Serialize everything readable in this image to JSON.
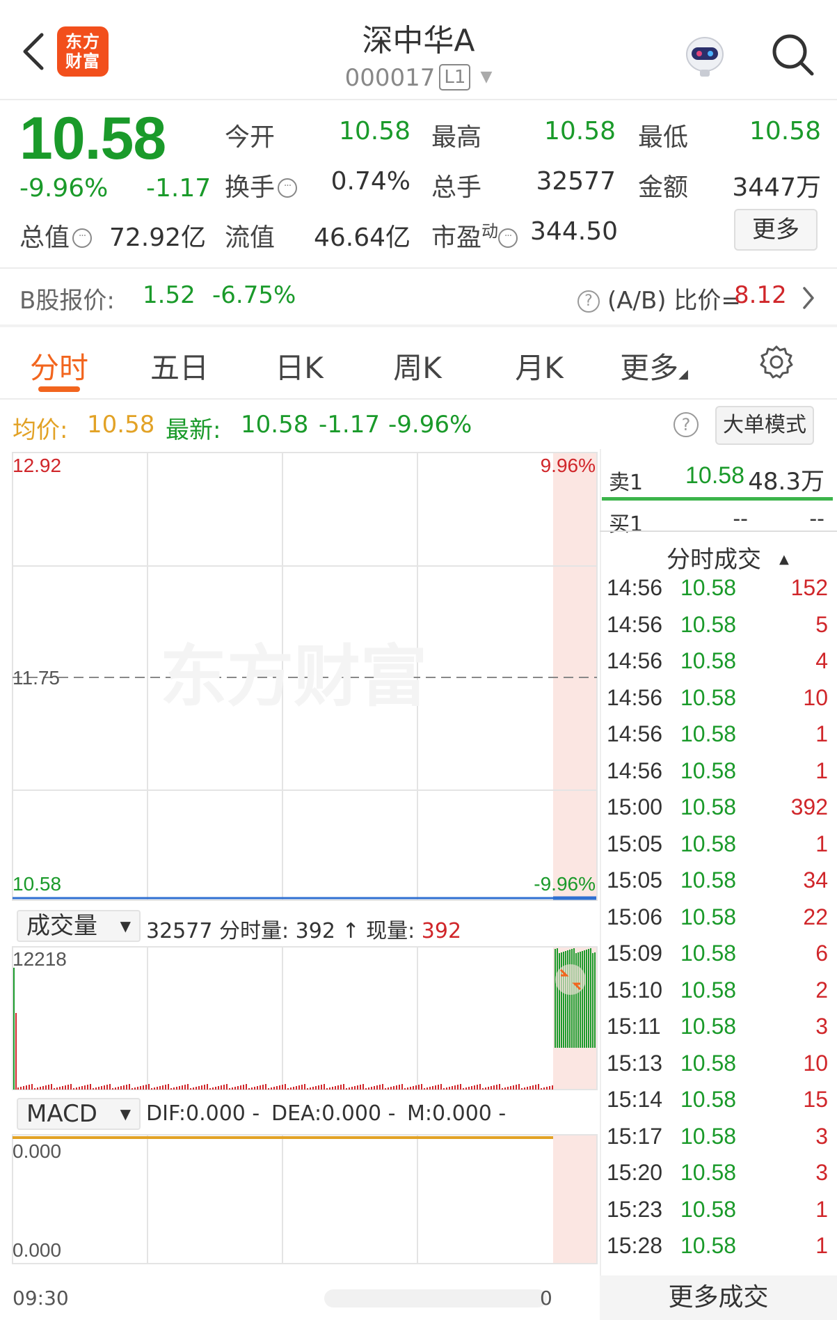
{
  "header": {
    "logo_line1": "东方",
    "logo_line2": "财富",
    "title": "深中华A",
    "code": "000017",
    "level_badge": "L1"
  },
  "quote": {
    "price": "10.58",
    "change_pct": "-9.96%",
    "change_abs": "-1.17",
    "open_label": "今开",
    "open_value": "10.58",
    "high_label": "最高",
    "high_value": "10.58",
    "low_label": "最低",
    "low_value": "10.58",
    "turnover_label": "换手",
    "turnover_value": "0.74%",
    "volume_label": "总手",
    "volume_value": "32577",
    "amount_label": "金额",
    "amount_value": "3447万",
    "mktcap_label": "总值",
    "mktcap_value": "72.92亿",
    "float_label": "流值",
    "float_value": "46.64亿",
    "pe_label": "市盈",
    "pe_sup": "动",
    "pe_value": "344.50",
    "more_label": "更多"
  },
  "bshare": {
    "label": "B股报价:",
    "price": "1.52",
    "pct": "-6.75%",
    "ratio_label": "(A/B) 比价=",
    "ratio_value": "8.12"
  },
  "tabs": [
    "分时",
    "五日",
    "日K",
    "周K",
    "月K",
    "更多"
  ],
  "chart_info": {
    "avg_label": "均价:",
    "avg_value": "10.58",
    "latest_label": "最新:",
    "latest_value": "10.58",
    "latest_chg": "-1.17",
    "latest_pct": "-9.96%",
    "bigorder_label": "大单模式"
  },
  "price_chart": {
    "y_top": "12.92",
    "y_mid": "11.75",
    "y_bottom": "10.58",
    "pct_top": "9.96%",
    "pct_bottom": "-9.96%",
    "watermark": "东方财富"
  },
  "volume_panel": {
    "select_label": "成交量",
    "total": "32577",
    "bar_label": "分时量:",
    "bar_value": "392",
    "now_label": "现量:",
    "now_value": "392",
    "y_max": "12218"
  },
  "macd_panel": {
    "select_label": "MACD",
    "dif": "DIF:0.000 -",
    "dea": "DEA:0.000 -",
    "m": "M:0.000 -",
    "y_top": "0.000",
    "y_bottom": "0.000",
    "x_start": "09:30",
    "x_end": "0"
  },
  "orderbook": {
    "sell1_label": "卖1",
    "sell1_price": "10.58",
    "sell1_vol": "48.3万",
    "buy1_label": "买1",
    "buy1_price": "--",
    "buy1_vol": "--",
    "trades_title": "分时成交",
    "more_trades": "更多成交"
  },
  "trades": [
    {
      "time": "14:56",
      "price": "10.58",
      "vol": "152"
    },
    {
      "time": "14:56",
      "price": "10.58",
      "vol": "5"
    },
    {
      "time": "14:56",
      "price": "10.58",
      "vol": "4"
    },
    {
      "time": "14:56",
      "price": "10.58",
      "vol": "10"
    },
    {
      "time": "14:56",
      "price": "10.58",
      "vol": "1"
    },
    {
      "time": "14:56",
      "price": "10.58",
      "vol": "1"
    },
    {
      "time": "15:00",
      "price": "10.58",
      "vol": "392"
    },
    {
      "time": "15:05",
      "price": "10.58",
      "vol": "1"
    },
    {
      "time": "15:05",
      "price": "10.58",
      "vol": "34"
    },
    {
      "time": "15:06",
      "price": "10.58",
      "vol": "22"
    },
    {
      "time": "15:09",
      "price": "10.58",
      "vol": "6"
    },
    {
      "time": "15:10",
      "price": "10.58",
      "vol": "2"
    },
    {
      "time": "15:11",
      "price": "10.58",
      "vol": "3"
    },
    {
      "time": "15:13",
      "price": "10.58",
      "vol": "10"
    },
    {
      "time": "15:14",
      "price": "10.58",
      "vol": "15"
    },
    {
      "time": "15:17",
      "price": "10.58",
      "vol": "3"
    },
    {
      "time": "15:20",
      "price": "10.58",
      "vol": "3"
    },
    {
      "time": "15:23",
      "price": "10.58",
      "vol": "1"
    },
    {
      "time": "15:28",
      "price": "10.58",
      "vol": "1"
    }
  ],
  "colors": {
    "up": "#d0262a",
    "down": "#1a9a2a",
    "accent": "#f2651e",
    "avg_line": "#e2a226",
    "price_line": "#2f6fd1"
  }
}
